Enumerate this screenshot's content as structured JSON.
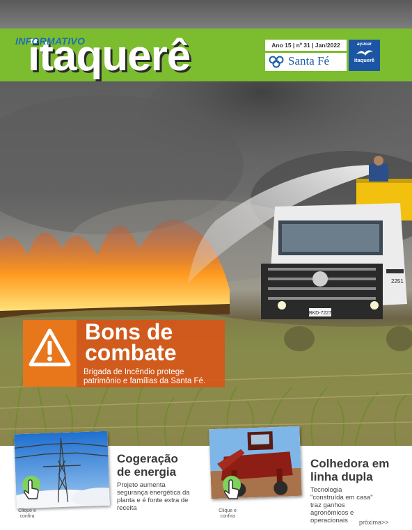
{
  "header": {
    "brand_small": "INFORMATIVO",
    "brand_big": "itaquerê",
    "issue": "Ano 15 | nº 31 | Jan/2022",
    "partner_name": "Santa Fé",
    "partner_logo_top": "açúcar",
    "partner_logo_bottom": "itaquerê"
  },
  "feature": {
    "icon": "warning-icon",
    "title_line1": "Bons de",
    "title_line2": "combate",
    "subtitle": "Brigada de Incêndio protege patrimônio e famílias da Santa Fé."
  },
  "articles": [
    {
      "title": "Cogeração de energia",
      "description": "Projeto aumenta segurança energética da planta e é fonte extra de receita",
      "hint": "Clique e confira",
      "image": "power-tower"
    },
    {
      "title": "Colhedora em linha dupla",
      "description": "Tecnologia \"construída em casa\" traz ganhos agronômicos e operacionais",
      "hint": "Clique e confira",
      "image": "harvester"
    }
  ],
  "truck_plate": "BKD-7227",
  "truck_number": "2251",
  "navigation": {
    "next_label": "próxima>>"
  },
  "colors": {
    "header_green": "#7bbd2f",
    "brand_blue": "#1c6db5",
    "feature_orange": "#e8761b",
    "feature_red": "#e05014",
    "click_green": "#7ed35a"
  }
}
